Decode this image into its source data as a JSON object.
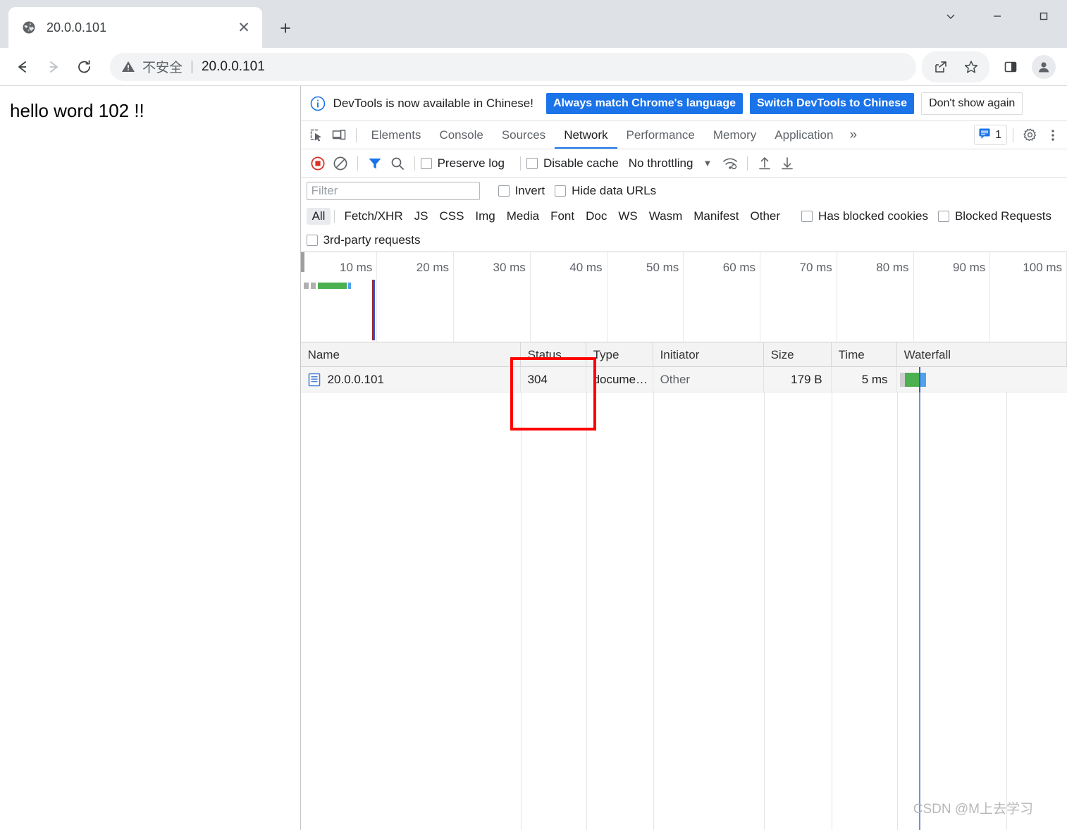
{
  "window": {
    "controls": [
      {
        "name": "tab-search-chevron",
        "glyph": "⌄"
      },
      {
        "name": "minimize",
        "glyph": "—"
      },
      {
        "name": "maximize",
        "glyph": "□"
      }
    ]
  },
  "tabstrip": {
    "tab_title": "20.0.0.101",
    "close_glyph": "✕",
    "newtab_glyph": "+"
  },
  "omnibox": {
    "back_glyph": "←",
    "forward_glyph": "→",
    "reload_glyph": "⟳",
    "security_label": "不安全",
    "separator": "|",
    "url": "20.0.0.101"
  },
  "page": {
    "body_text": "hello word 102 !!"
  },
  "devtools": {
    "banner": {
      "message": "DevTools is now available in Chinese!",
      "btn_always_match": "Always match Chrome's language",
      "btn_switch": "Switch DevTools to Chinese",
      "btn_dont_show": "Don't show again"
    },
    "tabs": [
      {
        "label": "Elements",
        "active": false
      },
      {
        "label": "Console",
        "active": false
      },
      {
        "label": "Sources",
        "active": false
      },
      {
        "label": "Network",
        "active": true
      },
      {
        "label": "Performance",
        "active": false
      },
      {
        "label": "Memory",
        "active": false
      },
      {
        "label": "Application",
        "active": false
      }
    ],
    "more_tabs_glyph": "»",
    "message_count": "1",
    "toolbar": {
      "preserve_log": "Preserve log",
      "disable_cache": "Disable cache",
      "throttling": "No throttling",
      "throttle_caret": "▼"
    },
    "filter": {
      "placeholder": "Filter",
      "value": "",
      "invert": "Invert",
      "hide_data_urls": "Hide data URLs"
    },
    "types": [
      "All",
      "Fetch/XHR",
      "JS",
      "CSS",
      "Img",
      "Media",
      "Font",
      "Doc",
      "WS",
      "Wasm",
      "Manifest",
      "Other"
    ],
    "type_active": "All",
    "has_blocked_cookies": "Has blocked cookies",
    "blocked_requests": "Blocked Requests",
    "third_party_requests": "3rd-party requests",
    "overview": {
      "ticks": [
        "10 ms",
        "20 ms",
        "30 ms",
        "40 ms",
        "50 ms",
        "60 ms",
        "70 ms",
        "80 ms",
        "90 ms",
        "100 ms"
      ]
    },
    "table": {
      "columns": [
        "Name",
        "Status",
        "Type",
        "Initiator",
        "Size",
        "Time",
        "Waterfall"
      ],
      "rows": [
        {
          "name": "20.0.0.101",
          "status": "304",
          "type": "docume…",
          "initiator": "Other",
          "size": "179 B",
          "time": "5 ms"
        }
      ]
    },
    "annotation": {
      "color": "#ff0000",
      "targets_column": "Status"
    },
    "colors": {
      "accent_blue": "#1a73e8",
      "record_red": "#d93025",
      "waterfall_green": "#4caf50",
      "waterfall_blue": "#4fa3ee",
      "waterfall_gray": "#b0b0b0"
    }
  },
  "watermark": "CSDN @M上去学习"
}
